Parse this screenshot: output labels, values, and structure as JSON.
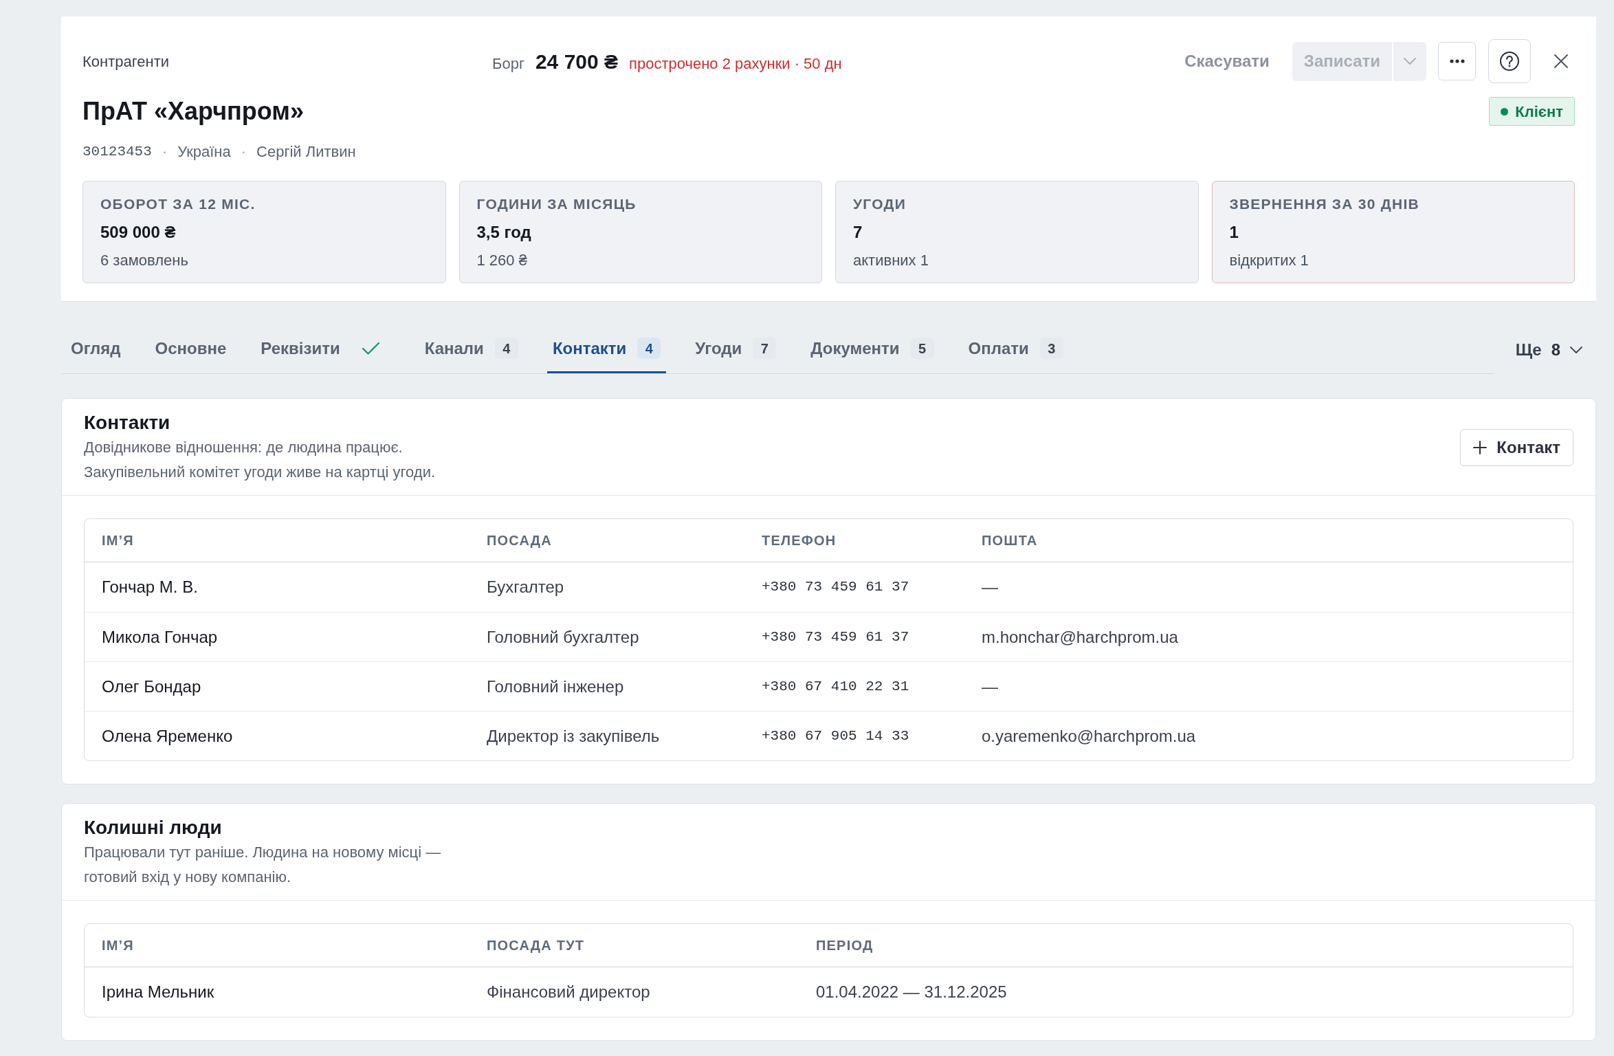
{
  "header": {
    "breadcrumb": "Контрагенти",
    "debt": {
      "label": "Борг",
      "amount": "24 700 ₴",
      "overdue": "прострочено 2 рахунки · 50 дн"
    },
    "actions": {
      "cancel": "Скасувати",
      "save": {
        "label": "Записати",
        "disabled": true
      }
    },
    "title": "ПрАТ «Харчпром»",
    "status": "Клієнт",
    "meta": [
      {
        "kind": "code",
        "text": "30123453"
      },
      {
        "kind": "separator",
        "text": "·"
      },
      {
        "kind": "text",
        "text": "Україна"
      },
      {
        "kind": "separator",
        "text": "·"
      },
      {
        "kind": "text",
        "text": "Сергій Литвин"
      }
    ],
    "stats": [
      {
        "label": "ОБОРОТ ЗА 12 МІС.",
        "value": "509 000 ₴",
        "caption": "6 замовлень",
        "alert": false
      },
      {
        "label": "ГОДИНИ ЗА МІСЯЦЬ",
        "value": "3,5 год",
        "caption": "1 260 ₴",
        "alert": false
      },
      {
        "label": "УГОДИ",
        "value": "7",
        "caption": "активних 1",
        "alert": false
      },
      {
        "label": "ЗВЕРНЕННЯ ЗА 30 ДНІВ",
        "value": "1",
        "caption": "відкритих 1",
        "alert": true
      }
    ]
  },
  "tabs": [
    {
      "label": "Огляд",
      "selected": false,
      "complete": false
    },
    {
      "label": "Основне",
      "selected": false,
      "complete": false
    },
    {
      "label": "Реквізити",
      "selected": false,
      "complete": true
    },
    {
      "label": "Канали",
      "selected": false,
      "complete": false,
      "count": "4"
    },
    {
      "label": "Контакти",
      "selected": true,
      "complete": false,
      "count": "4"
    },
    {
      "label": "Угоди",
      "selected": false,
      "complete": false,
      "count": "7"
    },
    {
      "label": "Документи",
      "selected": false,
      "complete": false,
      "count": "5"
    },
    {
      "label": "Оплати",
      "selected": false,
      "complete": false,
      "count": "3"
    }
  ],
  "more_tabs": {
    "label": "Ще",
    "count": "8"
  },
  "contacts": {
    "title": "Контакти",
    "description": [
      "Довідникове відношення: де людина працює.",
      "Закупівельний комітет угоди живе на картці угоди."
    ],
    "add_button": "Контакт",
    "table": {
      "columns": [
        {
          "label": "ІМ’Я",
          "kind": "name"
        },
        {
          "label": "ПОСАДА",
          "kind": "text"
        },
        {
          "label": "ТЕЛЕФОН",
          "kind": "mono"
        },
        {
          "label": "ПОШТА",
          "kind": "text"
        }
      ],
      "rows": [
        [
          "Гончар М. В.",
          "Бухгалтер",
          "+380 73 459 61 37",
          "—"
        ],
        [
          "Микола Гончар",
          "Головний бухгалтер",
          "+380 73 459 61 37",
          "m.honchar@harchprom.ua"
        ],
        [
          "Олег Бондар",
          "Головний інженер",
          "+380 67 410 22 31",
          "—"
        ],
        [
          "Олена Яременко",
          "Директор із закупівель",
          "+380 67 905 14 33",
          "o.yaremenko@harchprom.ua"
        ]
      ]
    }
  },
  "former_people": {
    "title": "Колишні люди",
    "description": [
      "Працювали тут раніше. Людина на новому місці — готовий вхід у нову компанію."
    ],
    "table": {
      "columns": [
        {
          "label": "ІМ’Я",
          "kind": "name"
        },
        {
          "label": "ПОСАДА ТУТ",
          "kind": "text"
        },
        {
          "label": "ПЕРІОД",
          "kind": "text"
        }
      ],
      "rows": [
        [
          "Ірина Мельник",
          "Фінансовий директор",
          "01.04.2022 — 31.12.2025"
        ]
      ]
    }
  }
}
